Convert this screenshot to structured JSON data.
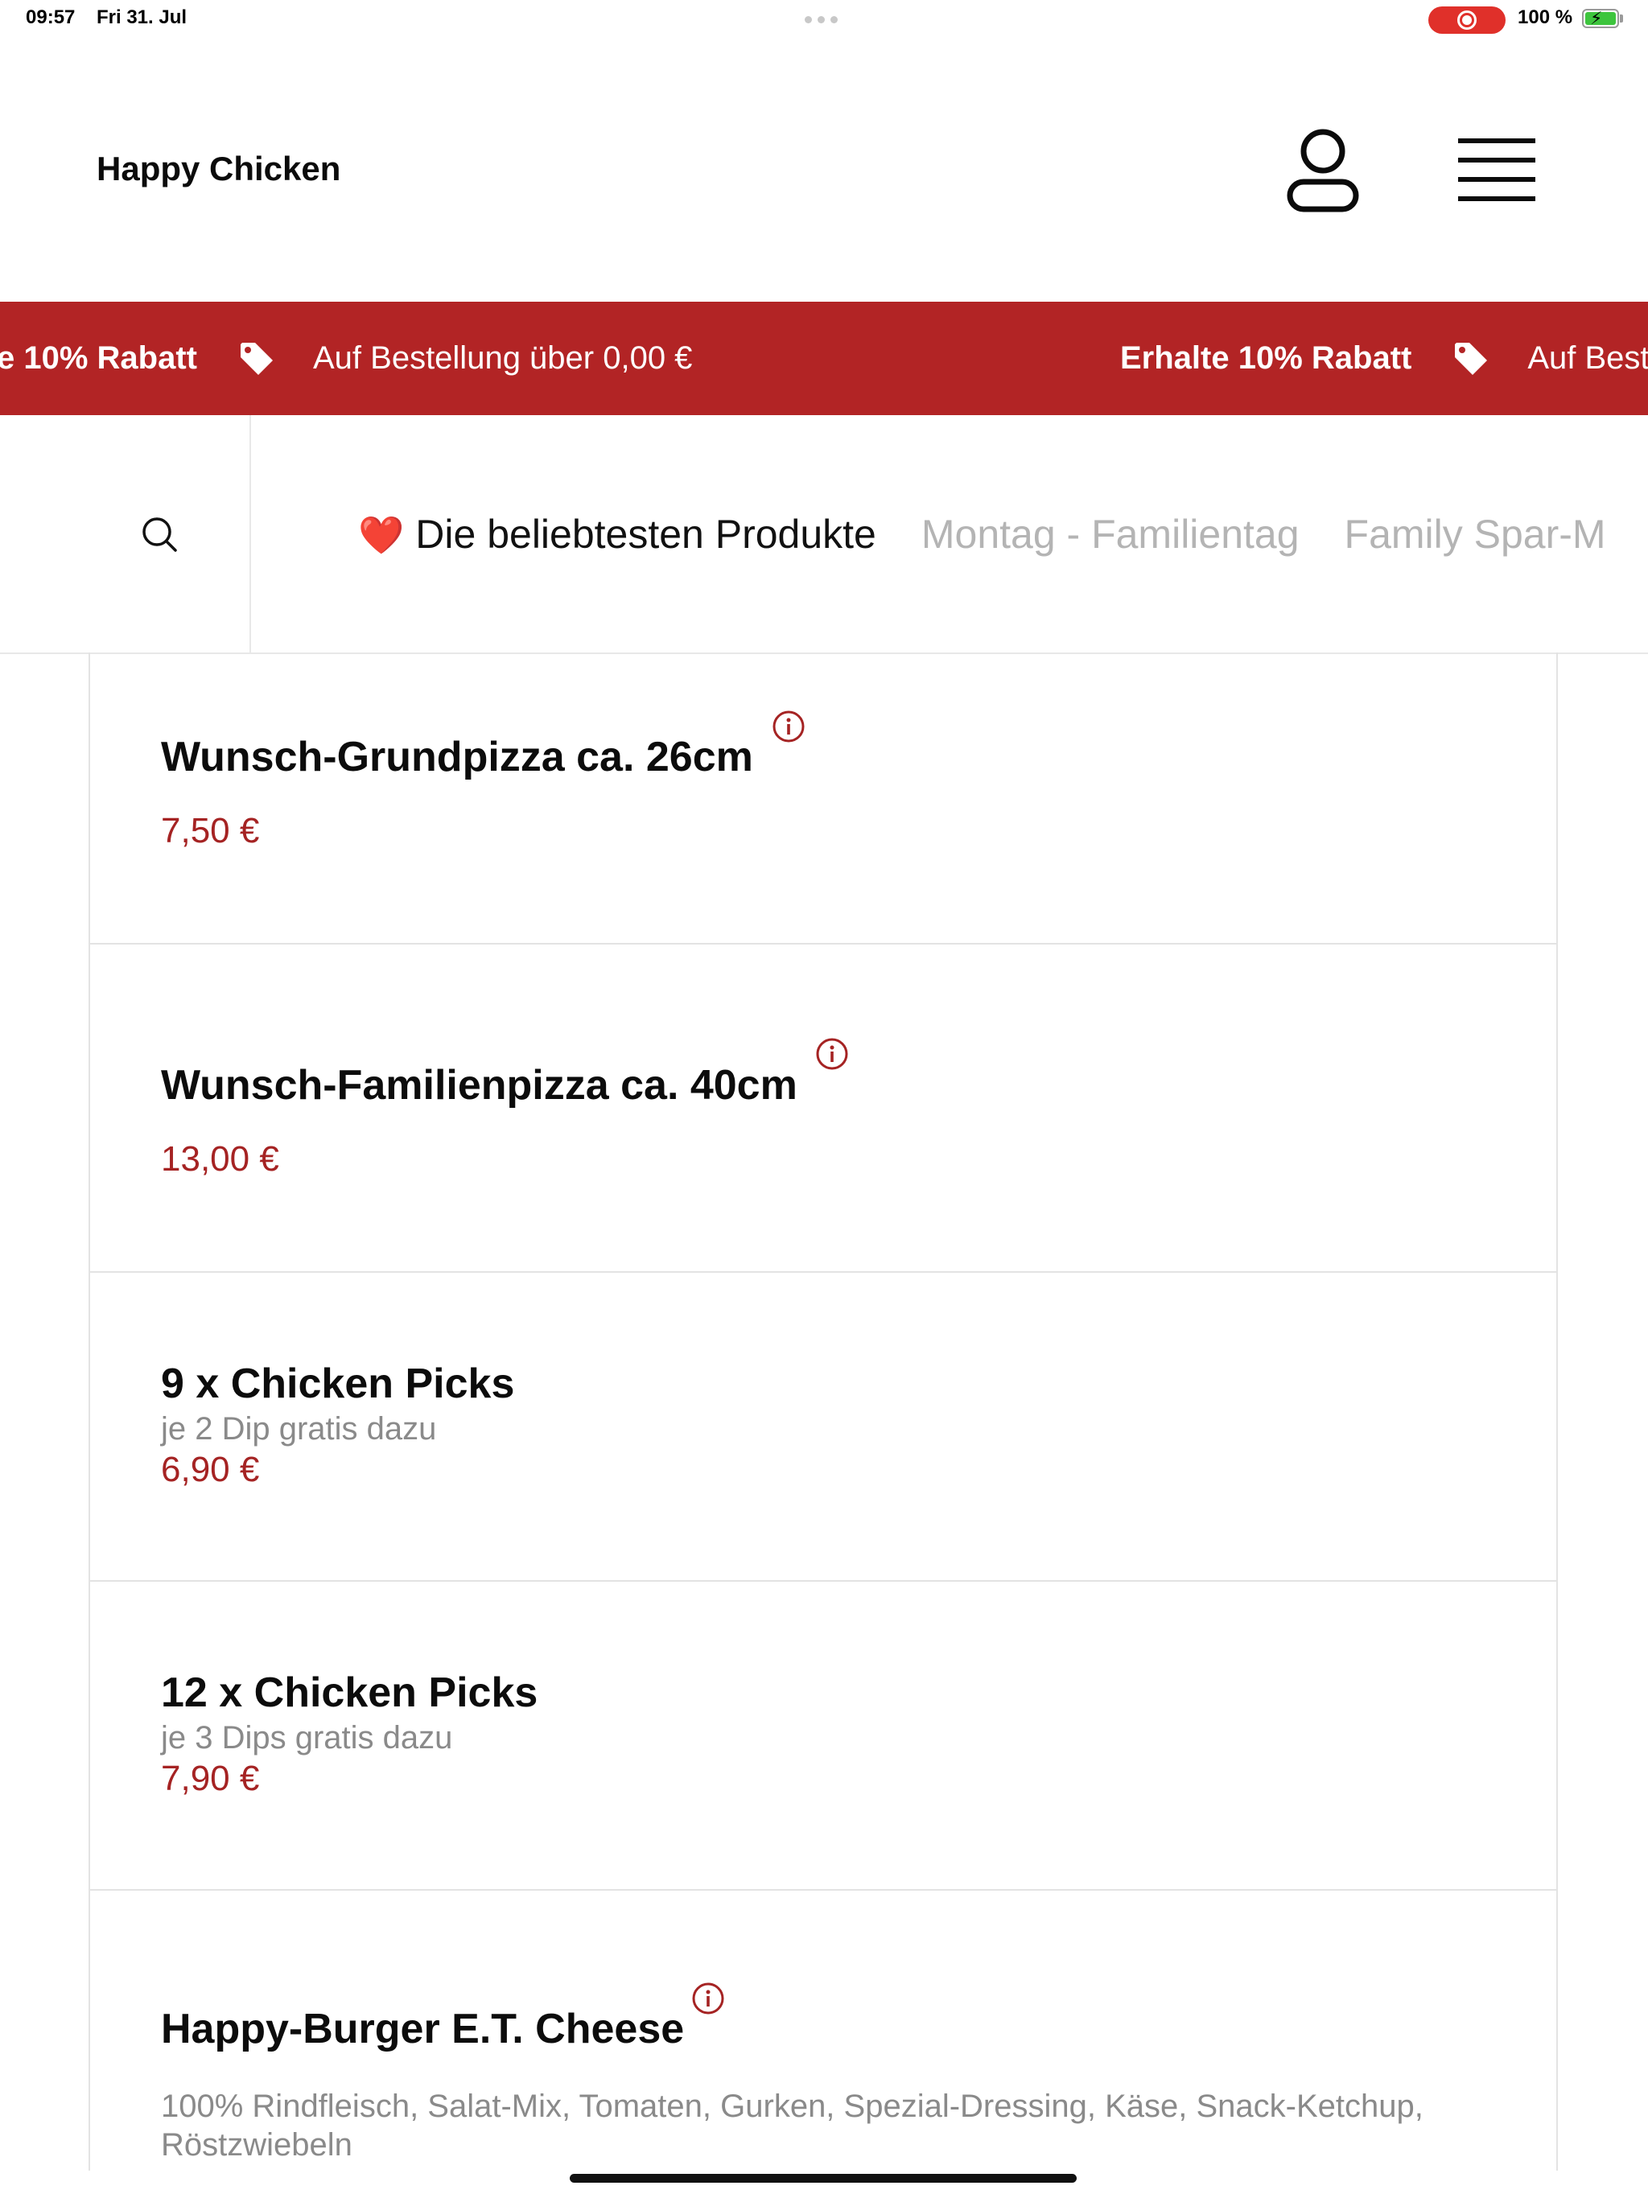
{
  "status_bar": {
    "time": "09:57",
    "date": "Fri 31. Jul",
    "battery": "100 %"
  },
  "header": {
    "title": "Happy Chicken",
    "account_icon": "person-icon",
    "menu_icon": "hamburger-menu-icon"
  },
  "promo": {
    "items": [
      {
        "bold": "e 10% Rabatt",
        "text": "Auf Bestellung über 0,00 €"
      },
      {
        "bold": "Erhalte 10% Rabatt",
        "text": "Auf Best"
      }
    ],
    "icon": "tag-icon"
  },
  "categories": {
    "search_icon": "search-icon",
    "tabs": [
      {
        "icon": "❤️",
        "label": "Die beliebtesten Produkte",
        "active": true
      },
      {
        "label": "Montag - Familientag",
        "active": false
      },
      {
        "label": "Family Spar-M",
        "active": false
      }
    ]
  },
  "products": [
    {
      "name": "Wunsch-Grundpizza ca. 26cm",
      "price": "7,50 €",
      "info": true
    },
    {
      "name": "Wunsch-Familienpizza ca. 40cm",
      "price": "13,00 €",
      "info": true
    },
    {
      "name": "9 x Chicken Picks",
      "description": "je 2 Dip gratis dazu",
      "price": "6,90 €"
    },
    {
      "name": "12 x Chicken Picks",
      "description": "je 3 Dips gratis dazu",
      "price": "7,90 €"
    },
    {
      "name": "Happy-Burger E.T. Cheese",
      "description": "100% Rindfleisch, Salat-Mix, Tomaten, Gurken, Spezial-Dressing, Käse, Snack-Ketchup, Röstzwiebeln",
      "info": true
    }
  ],
  "colors": {
    "brand_red": "#b22425",
    "price_red": "#a52323",
    "record_red": "#e0302a"
  }
}
